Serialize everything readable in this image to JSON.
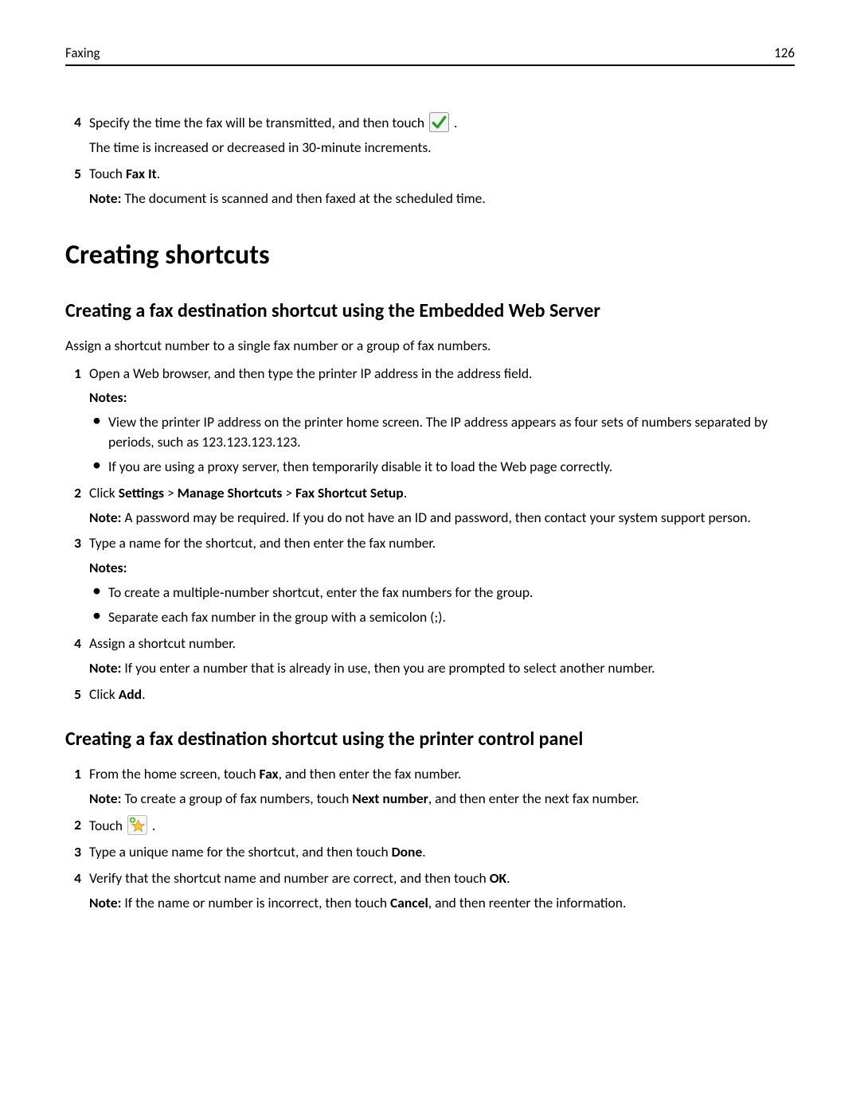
{
  "header": {
    "section": "Faxing",
    "page": "126"
  },
  "top_steps": [
    {
      "n": "4",
      "lines": [
        {
          "segments": [
            "Specify the time the fax will be transmitted, and then touch ",
            {
              "icon": "checkmark-icon"
            },
            " ."
          ]
        },
        {
          "segments": [
            "The time is increased or decreased in 30‑minute increments."
          ]
        }
      ]
    },
    {
      "n": "5",
      "lines": [
        {
          "segments": [
            "Touch ",
            {
              "bold": "Fax It"
            },
            "."
          ]
        },
        {
          "note": true,
          "segments": [
            {
              "bold": "Note:"
            },
            " The document is scanned and then faxed at the scheduled time."
          ]
        }
      ]
    }
  ],
  "h1": "Creating shortcuts",
  "sectionA": {
    "title": "Creating a fax destination shortcut using the Embedded Web Server",
    "intro": "Assign a shortcut number to a single fax number or a group of fax numbers.",
    "steps": [
      {
        "n": "1",
        "lines": [
          {
            "segments": [
              "Open a Web browser, and then type the printer IP address in the address field."
            ]
          }
        ],
        "notes_label": "Notes:",
        "bullets": [
          "View the printer IP address on the printer home screen. The IP address appears as four sets of numbers separated by periods, such as 123.123.123.123.",
          "If you are using a proxy server, then temporarily disable it to load the Web page correctly."
        ]
      },
      {
        "n": "2",
        "lines": [
          {
            "segments": [
              "Click ",
              {
                "bold": "Settings"
              },
              " > ",
              {
                "bold": "Manage Shortcuts"
              },
              " > ",
              {
                "bold": "Fax Shortcut Setup"
              },
              "."
            ]
          },
          {
            "note": true,
            "segments": [
              {
                "bold": "Note:"
              },
              " A password may be required. If you do not have an ID and password, then contact your system support person."
            ]
          }
        ]
      },
      {
        "n": "3",
        "lines": [
          {
            "segments": [
              "Type a name for the shortcut, and then enter the fax number."
            ]
          }
        ],
        "notes_label": "Notes:",
        "bullets": [
          "To create a multiple‑number shortcut, enter the fax numbers for the group.",
          "Separate each fax number in the group with a semicolon (;)."
        ]
      },
      {
        "n": "4",
        "lines": [
          {
            "segments": [
              "Assign a shortcut number."
            ]
          },
          {
            "note": true,
            "segments": [
              {
                "bold": "Note:"
              },
              " If you enter a number that is already in use, then you are prompted to select another number."
            ]
          }
        ]
      },
      {
        "n": "5",
        "lines": [
          {
            "segments": [
              "Click ",
              {
                "bold": "Add"
              },
              "."
            ]
          }
        ]
      }
    ]
  },
  "sectionB": {
    "title": "Creating a fax destination shortcut using the printer control panel",
    "steps": [
      {
        "n": "1",
        "lines": [
          {
            "segments": [
              "From the home screen, touch ",
              {
                "bold": "Fax"
              },
              ", and then enter the fax number."
            ]
          },
          {
            "note": true,
            "segments": [
              {
                "bold": "Note:"
              },
              " To create a group of fax numbers, touch ",
              {
                "bold": "Next number"
              },
              ", and then enter the next fax number."
            ]
          }
        ]
      },
      {
        "n": "2",
        "lines": [
          {
            "segments": [
              "Touch ",
              {
                "icon": "star-shortcut-icon"
              },
              " ."
            ]
          }
        ]
      },
      {
        "n": "3",
        "lines": [
          {
            "segments": [
              "Type a unique name for the shortcut, and then touch ",
              {
                "bold": "Done"
              },
              "."
            ]
          }
        ]
      },
      {
        "n": "4",
        "lines": [
          {
            "segments": [
              "Verify that the shortcut name and number are correct, and then touch ",
              {
                "bold": "OK"
              },
              "."
            ]
          },
          {
            "note": true,
            "segments": [
              {
                "bold": "Note:"
              },
              " If the name or number is incorrect, then touch ",
              {
                "bold": "Cancel"
              },
              ", and then reenter the information."
            ]
          }
        ]
      }
    ]
  }
}
